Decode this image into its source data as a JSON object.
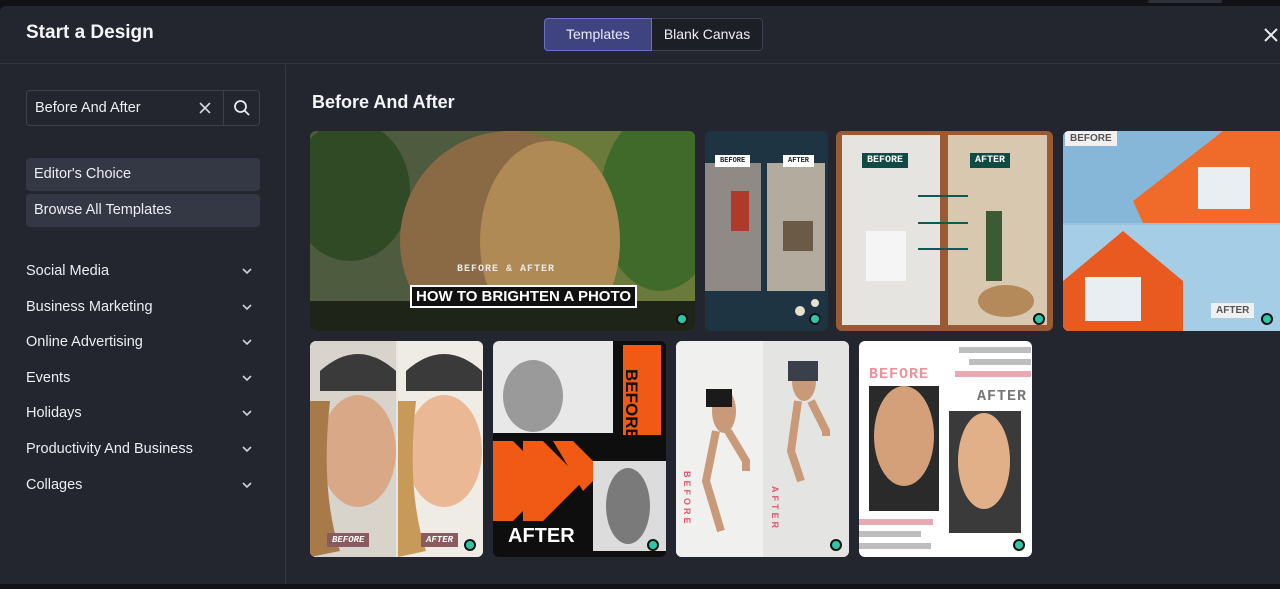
{
  "header": {
    "title": "Start a Design",
    "tabs": [
      {
        "label": "Templates",
        "active": true
      },
      {
        "label": "Blank Canvas",
        "active": false
      }
    ]
  },
  "icons": {
    "close": "close-icon",
    "clear": "clear-icon",
    "search": "search-icon",
    "chevron": "chevron-down-icon"
  },
  "search": {
    "value": "Before And After"
  },
  "sidebar": {
    "pills": [
      "Editor's Choice",
      "Browse All Templates"
    ],
    "categories": [
      "Social Media",
      "Business Marketing",
      "Online Advertising",
      "Events",
      "Holidays",
      "Productivity And Business",
      "Collages"
    ]
  },
  "main": {
    "title": "Before And After",
    "cards": [
      {
        "id": "hair",
        "caption_top": "BEFORE & AFTER",
        "caption_main": "HOW TO BRIGHTEN A PHOTO"
      },
      {
        "id": "room",
        "before": "BEFORE",
        "after": "AFTER"
      },
      {
        "id": "interior",
        "before": "BEFORE",
        "after": "AFTER"
      },
      {
        "id": "house",
        "before": "BEFORE",
        "after": "AFTER"
      },
      {
        "id": "smile",
        "before": "BEFORE",
        "after": "AFTER"
      },
      {
        "id": "fitness",
        "before": "BEFORE",
        "after": "AFTER"
      },
      {
        "id": "jump",
        "before": "BEFORE",
        "after": "AFTER"
      },
      {
        "id": "back",
        "before": "BEFORE",
        "after": "AFTER"
      }
    ]
  },
  "colors": {
    "accent": "#3f4480",
    "status_dot": "#2fc5a8",
    "panel": "#23252f"
  }
}
